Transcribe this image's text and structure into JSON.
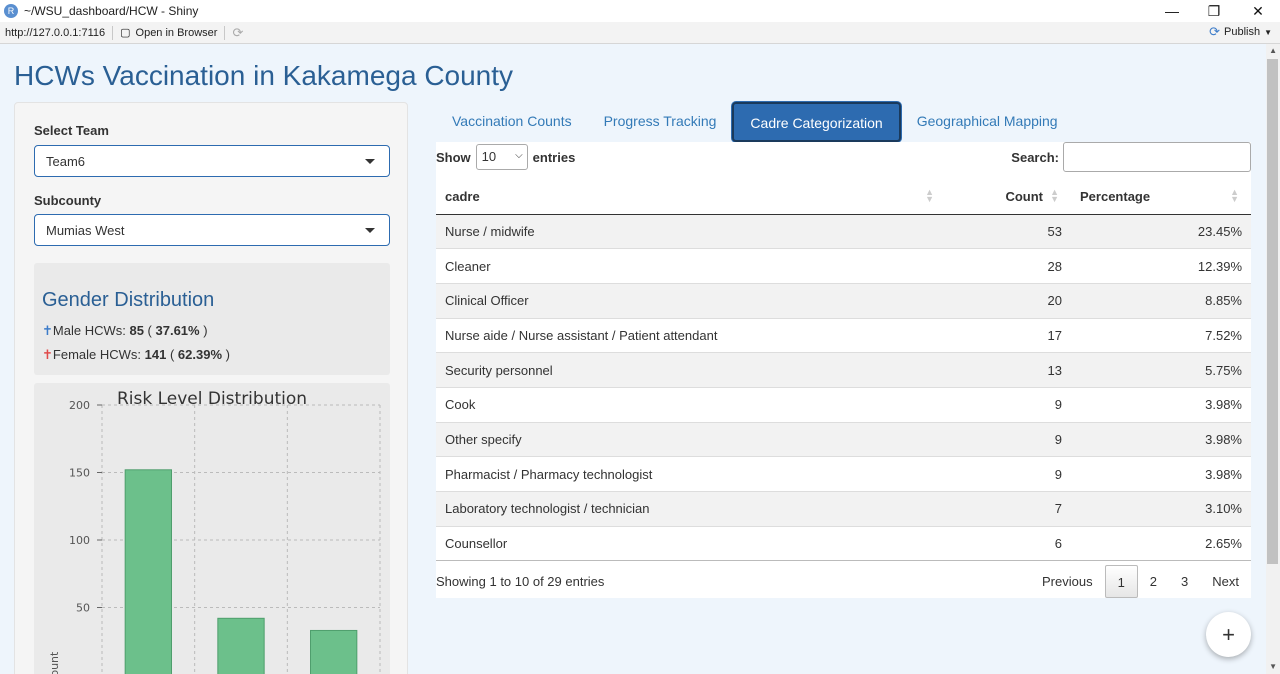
{
  "window": {
    "title": "~/WSU_dashboard/HCW - Shiny",
    "url": "http://127.0.0.1:7116",
    "open_in_browser": "Open in Browser",
    "publish": "Publish"
  },
  "page_title": "HCWs Vaccination in Kakamega County",
  "sidebar": {
    "team_label": "Select Team",
    "team_value": "Team6",
    "subcounty_label": "Subcounty",
    "subcounty_value": "Mumias West",
    "gender": {
      "title": "Gender Distribution",
      "male_prefix": "Male HCWs: ",
      "male_count": "85",
      "male_pct": "37.61%",
      "female_prefix": "Female HCWs: ",
      "female_count": "141",
      "female_pct": "62.39%"
    },
    "risk_title": "Risk Level Distribution"
  },
  "chart_data": {
    "type": "bar",
    "ylabel": "Count",
    "ylim": [
      0,
      200
    ],
    "yticks": [
      50,
      100,
      150,
      200
    ],
    "categories": [
      "",
      "",
      ""
    ],
    "values": [
      152,
      42,
      33
    ],
    "bar_color": "#6cc08b",
    "grid": true
  },
  "tabs": [
    {
      "label": "Vaccination Counts",
      "active": false
    },
    {
      "label": "Progress Tracking",
      "active": false
    },
    {
      "label": "Cadre Categorization",
      "active": true
    },
    {
      "label": "Geographical Mapping",
      "active": false
    }
  ],
  "table": {
    "show_label": "Show",
    "length_value": "10",
    "entries_label": "entries",
    "search_label": "Search:",
    "headers": [
      "cadre",
      "Count",
      "Percentage"
    ],
    "rows": [
      [
        "Nurse / midwife",
        "53",
        "23.45%"
      ],
      [
        "Cleaner",
        "28",
        "12.39%"
      ],
      [
        "Clinical Officer",
        "20",
        "8.85%"
      ],
      [
        "Nurse aide / Nurse assistant / Patient attendant",
        "17",
        "7.52%"
      ],
      [
        "Security personnel",
        "13",
        "5.75%"
      ],
      [
        "Cook",
        "9",
        "3.98%"
      ],
      [
        "Other specify",
        "9",
        "3.98%"
      ],
      [
        "Pharmacist / Pharmacy technologist",
        "9",
        "3.98%"
      ],
      [
        "Laboratory technologist / technician",
        "7",
        "3.10%"
      ],
      [
        "Counsellor",
        "6",
        "2.65%"
      ]
    ],
    "info": "Showing 1 to 10 of 29 entries",
    "pager": {
      "previous": "Previous",
      "pages": [
        "1",
        "2",
        "3"
      ],
      "current": "1",
      "next": "Next"
    }
  },
  "fab_label": "+",
  "colors": {
    "accent": "#2d6bb0",
    "title": "#2a5f94",
    "bar": "#6cc08b"
  }
}
